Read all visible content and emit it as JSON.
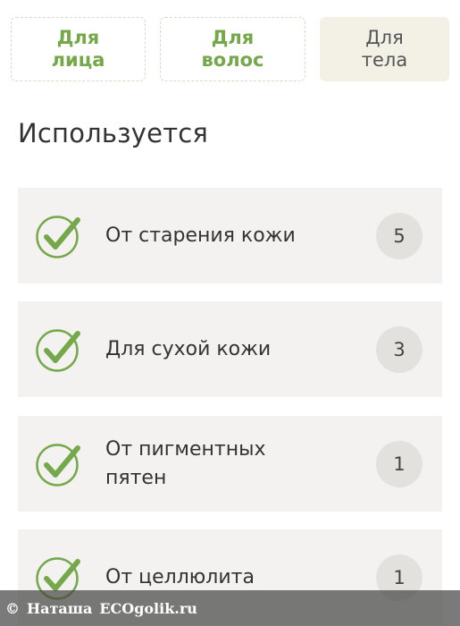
{
  "tabs": [
    {
      "line1": "Для",
      "line2": "лица",
      "active": false
    },
    {
      "line1": "Для",
      "line2": "волос",
      "active": false
    },
    {
      "line1": "Для",
      "line2": "тела",
      "active": true
    }
  ],
  "section_title": "Используется",
  "usage_items": [
    {
      "label": "От старения кожи",
      "count": "5"
    },
    {
      "label": "Для сухой кожи",
      "count": "3"
    },
    {
      "label": "От пигментных пятен",
      "count": "1"
    },
    {
      "label": "От целлюлита",
      "count": "1"
    }
  ],
  "watermark": {
    "copyright_symbol": "©",
    "author": "Наташа",
    "site": "ECOgolik.ru"
  },
  "colors": {
    "accent_green": "#75a84a",
    "active_tab_bg": "#f3f0e6",
    "item_bg": "#f3f2f0",
    "badge_bg": "#e2e1de"
  },
  "icons": {
    "check": "check-circle-icon"
  }
}
